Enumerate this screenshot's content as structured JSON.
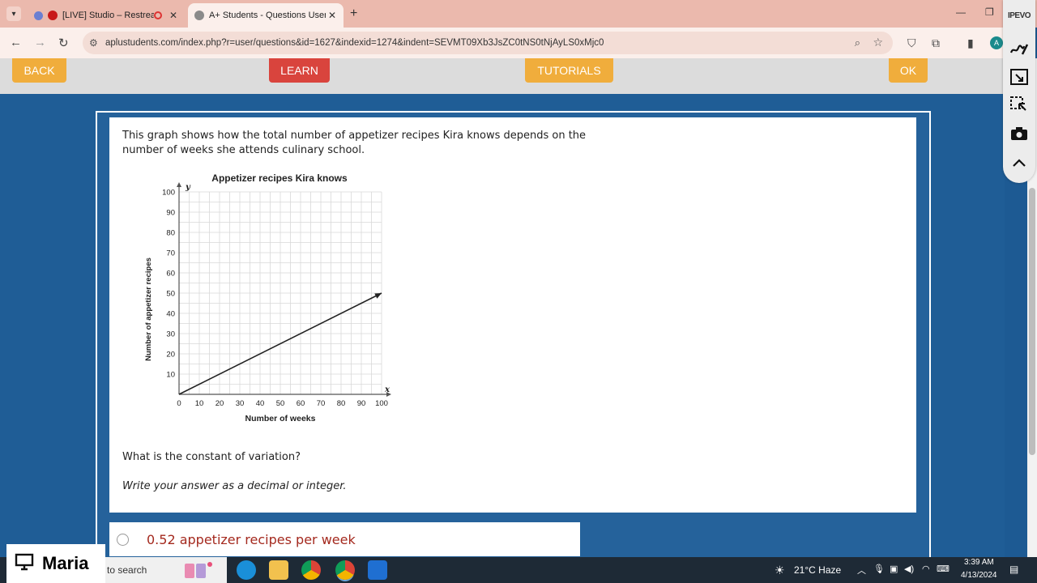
{
  "browser": {
    "tabs": [
      {
        "label": "[LIVE] Studio – Restream",
        "active": false
      },
      {
        "label": "A+ Students - Questions User",
        "active": true
      }
    ],
    "url": "aplustudents.com/index.php?r=user/questions&id=1627&indexid=1274&indent=SEVMT09Xb3JsZC0tNS0tNjAyLS0xMjc0",
    "icons": [
      "back-arrow",
      "forward-arrow",
      "reload",
      "zoom",
      "star",
      "extensions",
      "sidepanel"
    ],
    "profile_initial": "A"
  },
  "page_nav": {
    "back": "BACK",
    "learn": "LEARN",
    "tutorials": "TUTORIALS",
    "ok": "OK"
  },
  "question": {
    "prompt": "This graph shows how the total number of appetizer recipes Kira knows depends on the number of weeks she attends culinary school.",
    "ask": "What is the constant of variation?",
    "instruction": "Write your answer as a decimal or integer."
  },
  "chart_data": {
    "type": "line",
    "title": "Appetizer recipes Kira knows",
    "xlabel": "Number of weeks",
    "ylabel": "Number of appetizer recipes",
    "x_axis_letter": "x",
    "y_axis_letter": "y",
    "xlim": [
      0,
      100
    ],
    "ylim": [
      0,
      100
    ],
    "x_ticks": [
      0,
      10,
      20,
      30,
      40,
      50,
      60,
      70,
      80,
      90,
      100
    ],
    "y_ticks": [
      10,
      20,
      30,
      40,
      50,
      60,
      70,
      80,
      90,
      100
    ],
    "grid": true,
    "series": [
      {
        "x": [
          0,
          100
        ],
        "y": [
          0,
          50
        ],
        "arrow_end": true
      }
    ]
  },
  "answer": {
    "text": "0.52 appetizer recipes per week"
  },
  "ipevo": {
    "logo": "IPEVO",
    "buttons": [
      "pen-icon",
      "screen-capture-icon",
      "select-area-icon",
      "camera-icon",
      "chevron-up-icon"
    ]
  },
  "overlay": {
    "name": "Maria"
  },
  "taskbar": {
    "search_text": "to search",
    "weather": "21°C  Haze",
    "time": "3:39 AM",
    "date": "4/13/2024"
  }
}
